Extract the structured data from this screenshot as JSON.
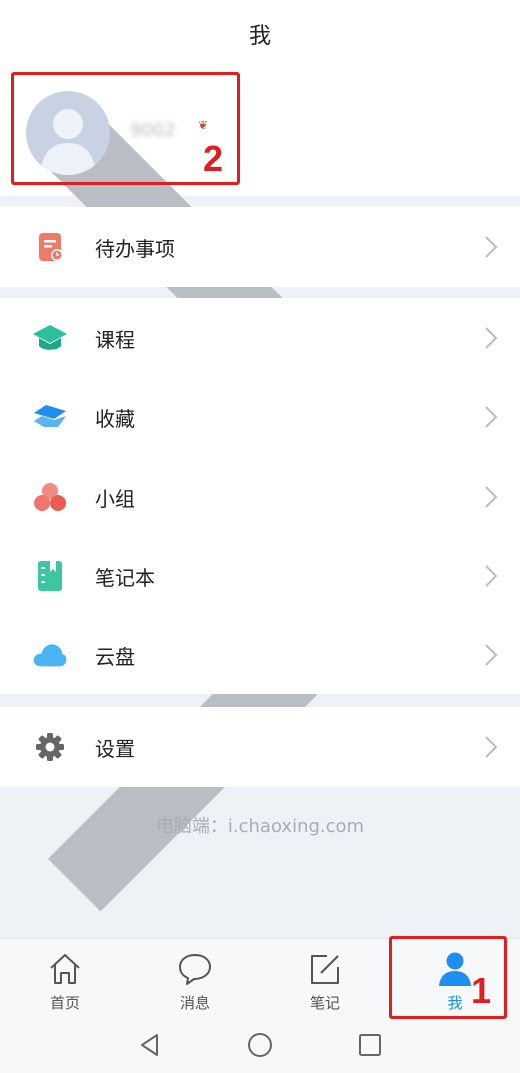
{
  "header": {
    "title": "我"
  },
  "profile": {
    "username": "9002",
    "decoration": "❦"
  },
  "menu_groups": {
    "todo": {
      "label": "待办事项",
      "icon": "todo-icon"
    },
    "courses": {
      "label": "课程",
      "icon": "course-icon"
    },
    "favorites": {
      "label": "收藏",
      "icon": "favorites-icon"
    },
    "groups": {
      "label": "小组",
      "icon": "group-icon"
    },
    "notebook": {
      "label": "笔记本",
      "icon": "notebook-icon"
    },
    "cloud": {
      "label": "云盘",
      "icon": "cloud-icon"
    },
    "settings": {
      "label": "设置",
      "icon": "gear-icon"
    }
  },
  "footer": {
    "text": "电脑端：i.chaoxing.com"
  },
  "tabbar": {
    "home": {
      "label": "首页",
      "icon": "home-icon"
    },
    "messages": {
      "label": "消息",
      "icon": "message-icon"
    },
    "notes": {
      "label": "笔记",
      "icon": "note-edit-icon"
    },
    "me": {
      "label": "我",
      "icon": "person-icon",
      "active": true
    }
  },
  "annotations": {
    "one": "1",
    "two": "2"
  },
  "colors": {
    "accent": "#1e8ef0",
    "annotation": "#e21d1d",
    "todo": "#f07a6a",
    "course": "#2bbf9e",
    "favorites": "#1e8ef0",
    "group": "#ef7469",
    "notebook": "#3cc6a2",
    "cloud": "#4ab4f5",
    "settings": "#666666"
  }
}
